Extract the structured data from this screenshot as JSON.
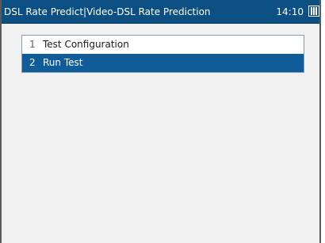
{
  "header": {
    "title": "DSL Rate Predict|Video-DSL Rate Prediction",
    "clock": "14:10",
    "battery_icon": "battery-icon"
  },
  "menu": {
    "items": [
      {
        "number": "1",
        "label": "Test Configuration",
        "selected": false
      },
      {
        "number": "2",
        "label": "Run Test",
        "selected": true
      }
    ]
  },
  "colors": {
    "titlebar": "#0c4f83",
    "selection": "#0f5c99",
    "background": "#f0f0f0"
  }
}
